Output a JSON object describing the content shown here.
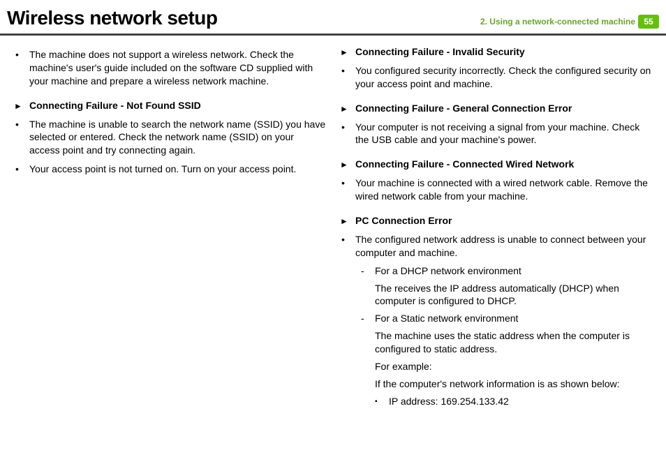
{
  "header": {
    "title": "Wireless network setup",
    "chapter_link": "2.  Using a network-connected machine",
    "page_number": "55"
  },
  "left_col": {
    "bullet1": "The machine does not support a wireless network. Check the machine's user's guide included on the software CD supplied with your machine and prepare a wireless network machine.",
    "section1_title": "Connecting Failure - Not Found SSID",
    "section1_b1": "The machine is unable to search the network name (SSID) you have selected or entered. Check the network name (SSID) on your access point and try connecting again.",
    "section1_b2": "Your access point is not turned on. Turn on your access point."
  },
  "right_col": {
    "section1_title": "Connecting Failure - Invalid Security",
    "section1_b1": "You configured security incorrectly. Check the configured security on your access point and machine.",
    "section2_title": "Connecting Failure - General Connection Error",
    "section2_b1": "Your computer is not receiving a signal from your machine. Check the USB cable and your machine's power.",
    "section3_title": "Connecting Failure - Connected Wired Network",
    "section3_b1": "Your machine is connected with a wired network cable. Remove the wired network cable from your machine.",
    "section4_title": "PC Connection Error",
    "section4_b1": "The configured network address is unable to connect between your computer and machine.",
    "sub1": "For a DHCP network environment",
    "sub1_p": "The receives the IP address automatically (DHCP) when computer is configured to DHCP.",
    "sub2": "For a Static network environment",
    "sub2_p": "The machine uses the static address when the computer is configured to static address.",
    "sub2_ex": "For example:",
    "sub2_info": "If the computer's network information is as shown below:",
    "sq1": "IP address: 169.254.133.42"
  }
}
